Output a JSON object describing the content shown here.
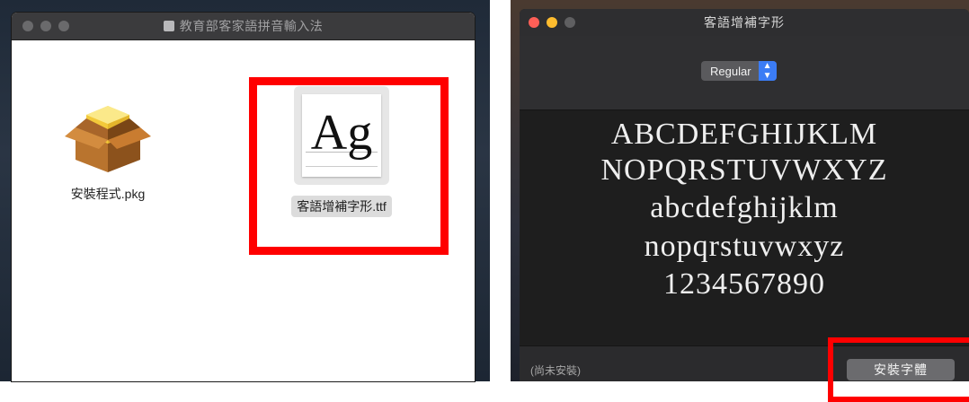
{
  "finder": {
    "title": "教育部客家語拼音輸入法",
    "items": [
      {
        "label": "安裝程式.pkg",
        "icon": "package-icon"
      },
      {
        "label": "客語增補字形.ttf",
        "icon": "font-file-icon",
        "thumbnail_text": "Ag"
      }
    ]
  },
  "font_window": {
    "title": "客語增補字形",
    "style_select": {
      "value": "Regular"
    },
    "preview_lines": [
      "ABCDEFGHIJKLM",
      "NOPQRSTUVWXYZ",
      "abcdefghijklm",
      "nopqrstuvwxyz",
      "1234567890"
    ],
    "status": "(尚未安裝)",
    "install_button": "安裝字體"
  },
  "colors": {
    "highlight": "#ff0000",
    "select_accent": "#3b7cf5"
  }
}
